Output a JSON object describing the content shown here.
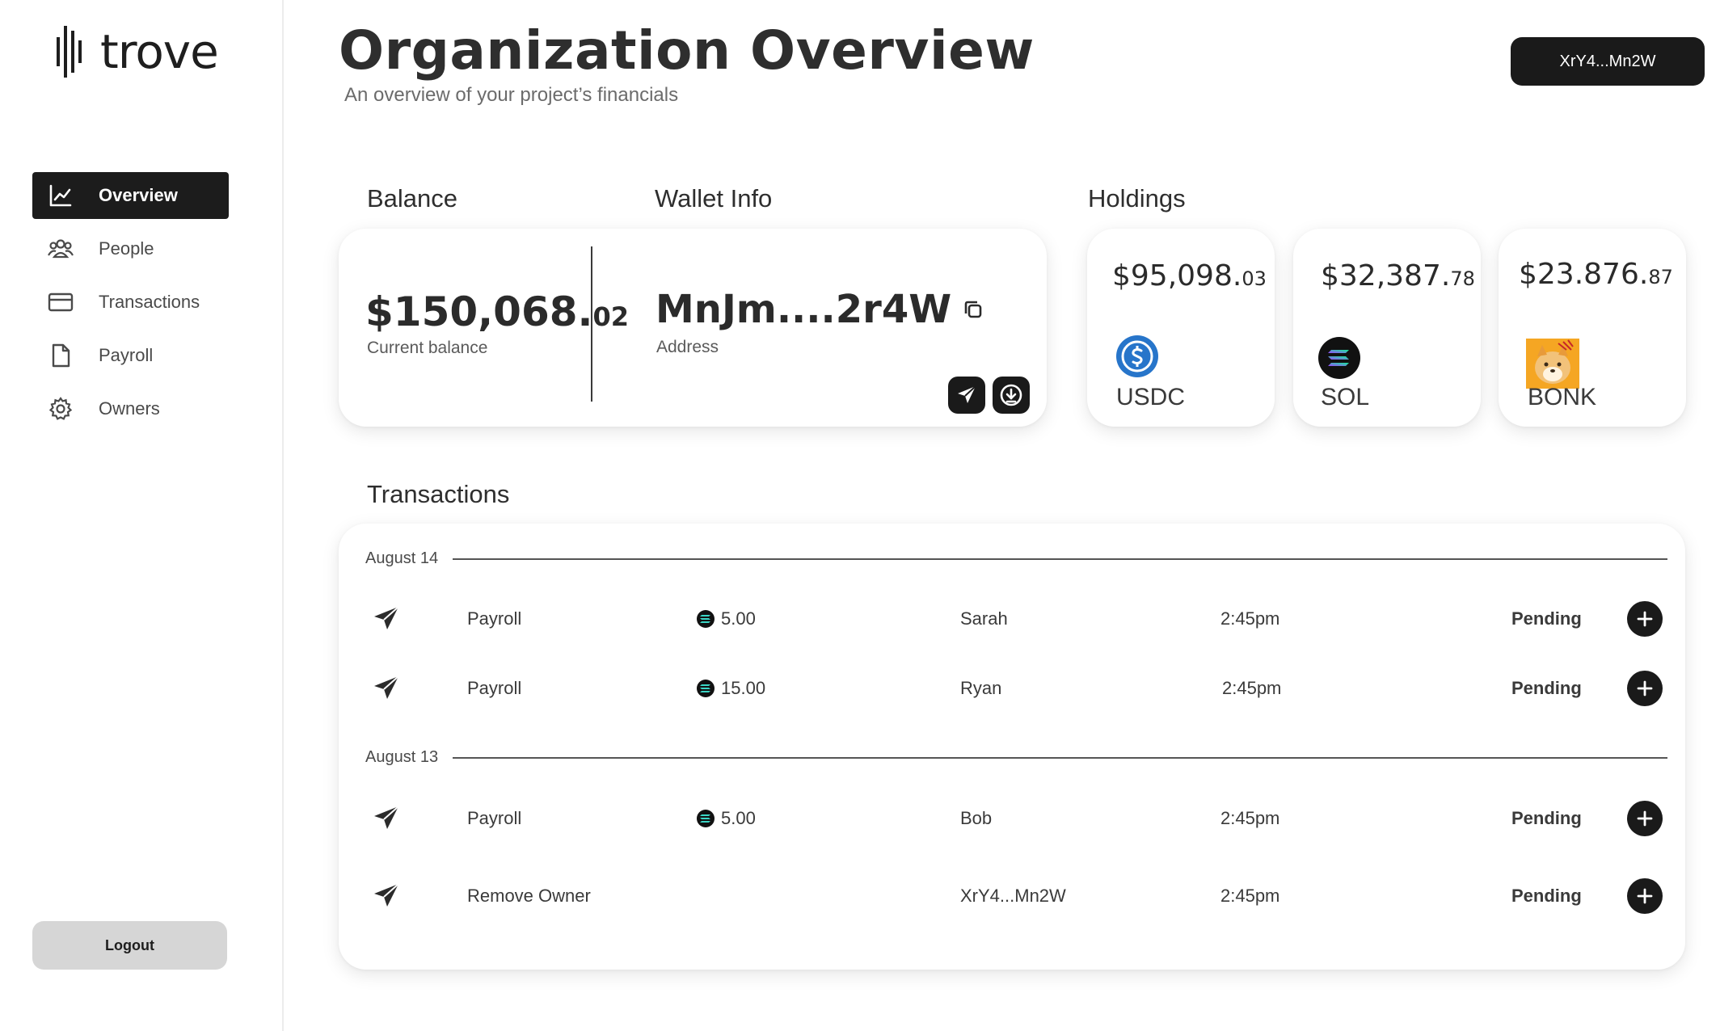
{
  "app": {
    "name": "trove"
  },
  "sidebar": {
    "items": [
      {
        "label": "Overview",
        "icon": "chart-line-icon",
        "active": true
      },
      {
        "label": "People",
        "icon": "people-icon",
        "active": false
      },
      {
        "label": "Transactions",
        "icon": "card-icon",
        "active": false
      },
      {
        "label": "Payroll",
        "icon": "document-icon",
        "active": false
      },
      {
        "label": "Owners",
        "icon": "gear-icon",
        "active": false
      }
    ],
    "logout_label": "Logout"
  },
  "header": {
    "title": "Organization Overview",
    "subtitle": "An overview of your project’s financials",
    "wallet_label": "XrY4...Mn2W"
  },
  "balance": {
    "section_label": "Balance",
    "amount_main": "$150,068.",
    "amount_cents": "02",
    "caption": "Current balance"
  },
  "wallet": {
    "section_label": "Wallet Info",
    "address": "MnJm....2r4W",
    "caption": "Address",
    "actions": [
      "send-icon",
      "download-icon"
    ]
  },
  "holdings": {
    "section_label": "Holdings",
    "items": [
      {
        "amount_main": "$95,098.",
        "amount_cents": "03",
        "symbol": "USDC",
        "icon": "usdc-icon",
        "color": "#2775ca"
      },
      {
        "amount_main": "$32,387.",
        "amount_cents": "78",
        "symbol": "SOL",
        "icon": "sol-icon",
        "color": "#111111"
      },
      {
        "amount_main": "$23.876.",
        "amount_cents": "87",
        "symbol": "BONK",
        "icon": "bonk-icon",
        "color": "#f5a623"
      }
    ]
  },
  "transactions": {
    "section_label": "Transactions",
    "groups": [
      {
        "date": "August 14",
        "rows": [
          {
            "type": "Payroll",
            "amount": "5.00",
            "person": "Sarah",
            "time": "2:45pm",
            "status": "Pending"
          },
          {
            "type": "Payroll",
            "amount": "15.00",
            "person": "Ryan",
            "time": "2:45pm",
            "status": "Pending"
          }
        ]
      },
      {
        "date": "August 13",
        "rows": [
          {
            "type": "Payroll",
            "amount": "5.00",
            "person": "Bob",
            "time": "2:45pm",
            "status": "Pending"
          },
          {
            "type": "Remove Owner",
            "amount": "",
            "person": "XrY4...Mn2W",
            "time": "2:45pm",
            "status": "Pending"
          }
        ]
      }
    ]
  },
  "colors": {
    "accent_dark": "#1a1a1a",
    "logout_bg": "#d6d6d6"
  }
}
